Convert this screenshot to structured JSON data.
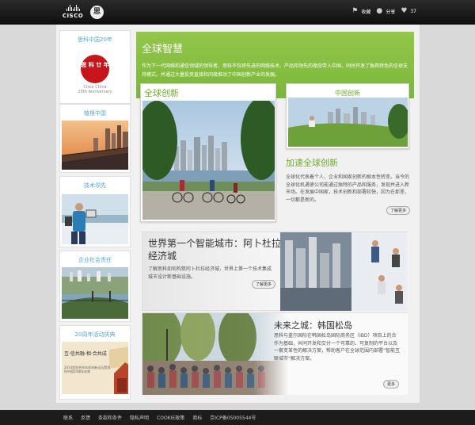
{
  "header": {
    "brand": "CISCO",
    "seal": "思",
    "tools": [
      {
        "icon": "tag-icon",
        "label": "收藏"
      },
      {
        "icon": "user-icon",
        "label": "分享"
      },
      {
        "icon": "heart-icon",
        "label": "37"
      }
    ]
  },
  "sidebar": {
    "items": [
      {
        "title": "思科中国20年",
        "emblem": "思 科 廿 年",
        "cap1": "Cisco China",
        "cap2": "20th Anniversary"
      },
      {
        "title": "植根中国"
      },
      {
        "title": "技术领先"
      },
      {
        "title": "企业社会责任"
      },
      {
        "title": "20周年活动庆典",
        "banner_text": "互·信共融·相·合共成",
        "banner_sub": "2014思科合作伙伴创新论坛暨思科中国20周年庆典"
      }
    ]
  },
  "hero": {
    "title": "全球智慧",
    "text": "作为下一代网络和通信领域的领导者，思科不仅将先进的网络技术、产品和领先的理念带入中国，同时开发了独具特色的全球支持模式，并通过大量投资直接和间接推动了中国创新产业的发展。"
  },
  "cards": {
    "global_innovation": {
      "title": "全球创新"
    },
    "china_innovation": {
      "title": "中国创新"
    },
    "accelerate": {
      "title": "加速全球创新",
      "text": "全球化代表着个人、企业和国家创新的根本性转变。当今的全球化机遇使公司能通过独特的产品和服务，发现并进入新市场。在发展中国家，技术创新和部署较快，因为在那里，一切都是新的。",
      "more": "了解更多"
    },
    "smart_city": {
      "title": "世界第一个智能城市：阿卜杜拉经济城",
      "text": "了解思科如何构筑阿卜杜拉经济城，世界上第一个技术集成城市设计新基础设施。",
      "more": "了解更多"
    },
    "songdo": {
      "title": "未来之城：韩国松岛",
      "text": "思科与盖尔国际在韩国松岛国际商务区（IBD）项目上的合作为基础，共同开发和交付一个可靠的、可复制的平台以及一套变革性的解决方案，帮助客户在全球范围内部署“智能互联城市”解决方案。",
      "more": "更多"
    }
  },
  "footer": {
    "links": [
      "联系",
      "反馈",
      "条款和条件",
      "隐私声明",
      "COOKIE政策",
      "商标",
      "京ICP备05005544号"
    ]
  }
}
